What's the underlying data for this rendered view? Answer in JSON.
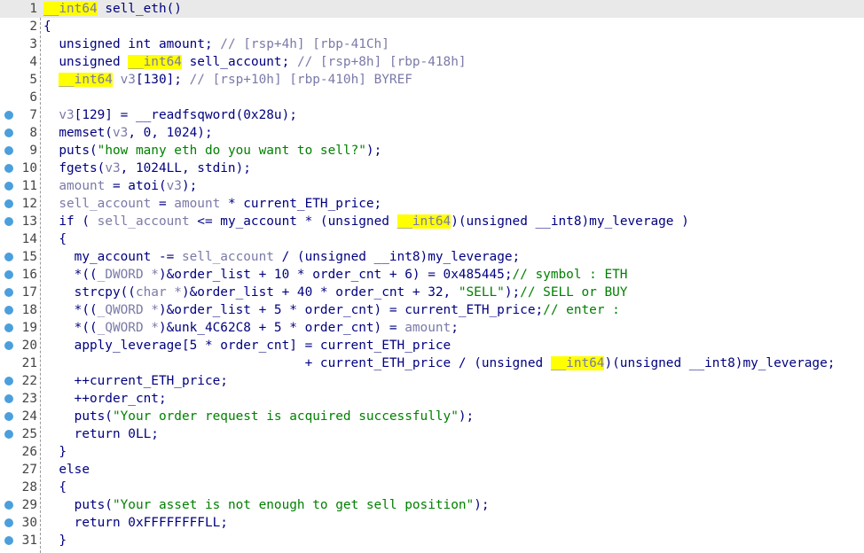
{
  "editor": {
    "colors": {
      "keyword": "#000080",
      "comment": "#7a7aa8",
      "string": "#008000",
      "highlight": "#ffff00",
      "breakpoint": "#4b9fdc"
    },
    "lines": [
      {
        "n": "1",
        "bp": false,
        "hl": true,
        "toks": [
          [
            "h",
            "__int64"
          ],
          [
            "k",
            " sell_eth()"
          ]
        ]
      },
      {
        "n": "2",
        "bp": false,
        "hl": false,
        "toks": [
          [
            "k",
            "{"
          ]
        ]
      },
      {
        "n": "3",
        "bp": false,
        "hl": false,
        "toks": [
          [
            "k",
            "  unsigned int amount; "
          ],
          [
            "c",
            "// [rsp+4h] [rbp-41Ch]"
          ]
        ]
      },
      {
        "n": "4",
        "bp": false,
        "hl": false,
        "toks": [
          [
            "k",
            "  unsigned "
          ],
          [
            "h",
            "__int64"
          ],
          [
            "k",
            " sell_account; "
          ],
          [
            "c",
            "// [rsp+8h] [rbp-418h]"
          ]
        ]
      },
      {
        "n": "5",
        "bp": false,
        "hl": false,
        "toks": [
          [
            "k",
            "  "
          ],
          [
            "h",
            "__int64"
          ],
          [
            "v",
            " v3"
          ],
          [
            "k",
            "[130]; "
          ],
          [
            "c",
            "// [rsp+10h] [rbp-410h] BYREF"
          ]
        ]
      },
      {
        "n": "6",
        "bp": false,
        "hl": false,
        "toks": []
      },
      {
        "n": "7",
        "bp": true,
        "hl": false,
        "toks": [
          [
            "v",
            "  v3"
          ],
          [
            "k",
            "[129] = __readfsqword(0x28u);"
          ]
        ]
      },
      {
        "n": "8",
        "bp": true,
        "hl": false,
        "toks": [
          [
            "k",
            "  memset("
          ],
          [
            "v",
            "v3"
          ],
          [
            "k",
            ", 0, 1024);"
          ]
        ]
      },
      {
        "n": "9",
        "bp": true,
        "hl": false,
        "toks": [
          [
            "k",
            "  puts("
          ],
          [
            "s",
            "\"how many eth do you want to sell?\""
          ],
          [
            "k",
            ");"
          ]
        ]
      },
      {
        "n": "10",
        "bp": true,
        "hl": false,
        "toks": [
          [
            "k",
            "  fgets("
          ],
          [
            "v",
            "v3"
          ],
          [
            "k",
            ", 1024LL, stdin);"
          ]
        ]
      },
      {
        "n": "11",
        "bp": true,
        "hl": false,
        "toks": [
          [
            "v",
            "  amount"
          ],
          [
            "k",
            " = atoi("
          ],
          [
            "v",
            "v3"
          ],
          [
            "k",
            ");"
          ]
        ]
      },
      {
        "n": "12",
        "bp": true,
        "hl": false,
        "toks": [
          [
            "v",
            "  sell_account"
          ],
          [
            "k",
            " = "
          ],
          [
            "v",
            "amount"
          ],
          [
            "k",
            " * current_ETH_price;"
          ]
        ]
      },
      {
        "n": "13",
        "bp": true,
        "hl": false,
        "toks": [
          [
            "k",
            "  if ( "
          ],
          [
            "v",
            "sell_account"
          ],
          [
            "k",
            " <= my_account * "
          ],
          [
            "p",
            "(unsigned "
          ],
          [
            "h",
            "__int64"
          ],
          [
            "p",
            ")(unsigned __int8)"
          ],
          [
            "k",
            "my_leverage )"
          ]
        ]
      },
      {
        "n": "14",
        "bp": false,
        "hl": false,
        "toks": [
          [
            "k",
            "  {"
          ]
        ]
      },
      {
        "n": "15",
        "bp": true,
        "hl": false,
        "toks": [
          [
            "k",
            "    my_account -= "
          ],
          [
            "v",
            "sell_account"
          ],
          [
            "k",
            " / "
          ],
          [
            "p",
            "(unsigned __int8)"
          ],
          [
            "k",
            "my_leverage;"
          ]
        ]
      },
      {
        "n": "16",
        "bp": true,
        "hl": false,
        "toks": [
          [
            "k",
            "    *(("
          ],
          [
            "c",
            "_DWORD *"
          ],
          [
            "k",
            ")&order_list + 10 * order_cnt + 6) = 0x485445;"
          ],
          [
            "s",
            "// symbol : ETH"
          ]
        ]
      },
      {
        "n": "17",
        "bp": true,
        "hl": false,
        "toks": [
          [
            "k",
            "    strcpy(("
          ],
          [
            "c",
            "char *"
          ],
          [
            "k",
            ")&order_list + 40 * order_cnt + 32, "
          ],
          [
            "s",
            "\"SELL\""
          ],
          [
            "k",
            ");"
          ],
          [
            "s",
            "// SELL or BUY"
          ]
        ]
      },
      {
        "n": "18",
        "bp": true,
        "hl": false,
        "toks": [
          [
            "k",
            "    *(("
          ],
          [
            "c",
            "_QWORD *"
          ],
          [
            "k",
            ")&order_list + 5 * order_cnt) = current_ETH_price;"
          ],
          [
            "s",
            "// enter :"
          ]
        ]
      },
      {
        "n": "19",
        "bp": true,
        "hl": false,
        "toks": [
          [
            "k",
            "    *(("
          ],
          [
            "c",
            "_QWORD *"
          ],
          [
            "k",
            ")&unk_4C62C8 + 5 * order_cnt) = "
          ],
          [
            "v",
            "amount"
          ],
          [
            "k",
            ";"
          ]
        ]
      },
      {
        "n": "20",
        "bp": true,
        "hl": false,
        "toks": [
          [
            "k",
            "    apply_leverage[5 * order_cnt] = current_ETH_price"
          ]
        ]
      },
      {
        "n": "21",
        "bp": false,
        "hl": false,
        "toks": [
          [
            "k",
            "                                  + current_ETH_price / "
          ],
          [
            "p",
            "(unsigned "
          ],
          [
            "h",
            "__int64"
          ],
          [
            "p",
            ")(unsigned __int8)"
          ],
          [
            "k",
            "my_leverage;"
          ]
        ]
      },
      {
        "n": "22",
        "bp": true,
        "hl": false,
        "toks": [
          [
            "k",
            "    ++current_ETH_price;"
          ]
        ]
      },
      {
        "n": "23",
        "bp": true,
        "hl": false,
        "toks": [
          [
            "k",
            "    ++order_cnt;"
          ]
        ]
      },
      {
        "n": "24",
        "bp": true,
        "hl": false,
        "toks": [
          [
            "k",
            "    puts("
          ],
          [
            "s",
            "\"Your order request is acquired successfully\""
          ],
          [
            "k",
            ");"
          ]
        ]
      },
      {
        "n": "25",
        "bp": true,
        "hl": false,
        "toks": [
          [
            "k",
            "    return 0LL;"
          ]
        ]
      },
      {
        "n": "26",
        "bp": false,
        "hl": false,
        "toks": [
          [
            "k",
            "  }"
          ]
        ]
      },
      {
        "n": "27",
        "bp": false,
        "hl": false,
        "toks": [
          [
            "k",
            "  else"
          ]
        ]
      },
      {
        "n": "28",
        "bp": false,
        "hl": false,
        "toks": [
          [
            "k",
            "  {"
          ]
        ]
      },
      {
        "n": "29",
        "bp": true,
        "hl": false,
        "toks": [
          [
            "k",
            "    puts("
          ],
          [
            "s",
            "\"Your asset is not enough to get sell position\""
          ],
          [
            "k",
            ");"
          ]
        ]
      },
      {
        "n": "30",
        "bp": true,
        "hl": false,
        "toks": [
          [
            "k",
            "    return 0xFFFFFFFFLL;"
          ]
        ]
      },
      {
        "n": "31",
        "bp": true,
        "hl": false,
        "toks": [
          [
            "k",
            "  }"
          ]
        ]
      }
    ]
  }
}
